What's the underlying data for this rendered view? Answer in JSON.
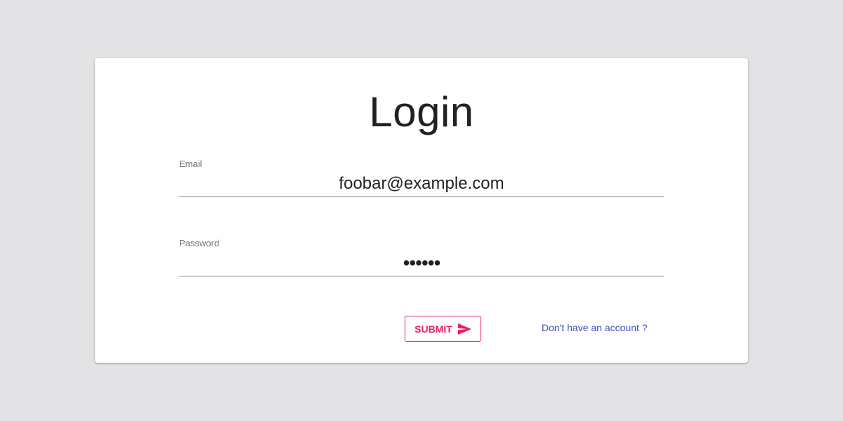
{
  "title": "Login",
  "form": {
    "email": {
      "label": "Email",
      "value": "foobar@example.com"
    },
    "password": {
      "label": "Password",
      "value": "••••••"
    },
    "submit_label": "SUBMIT",
    "submit_icon": "send-icon",
    "signup_link": "Don't have an account ?"
  },
  "colors": {
    "background": "#e3e3e5",
    "card": "#ffffff",
    "accent": "#e91e63",
    "link": "#3f51b5"
  }
}
